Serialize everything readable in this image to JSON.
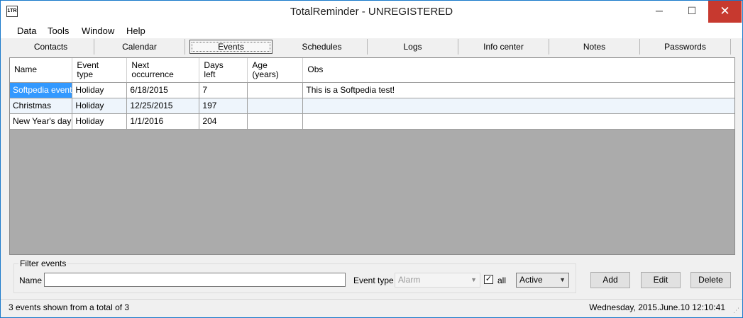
{
  "window": {
    "title": "TotalReminder - UNREGISTERED",
    "icon_text": "1TR",
    "minimize_glyph": "─",
    "maximize_glyph": "☐",
    "close_glyph": "✕"
  },
  "menu": [
    "Data",
    "Tools",
    "Window",
    "Help"
  ],
  "tabs": [
    "Contacts",
    "Calendar",
    "Events",
    "Schedules",
    "Logs",
    "Info center",
    "Notes",
    "Passwords"
  ],
  "active_tab": "Events",
  "table": {
    "columns": [
      {
        "line1": "Name",
        "line2": ""
      },
      {
        "line1": "Event",
        "line2": "type"
      },
      {
        "line1": "Next",
        "line2": "occurrence"
      },
      {
        "line1": "Days",
        "line2": "left"
      },
      {
        "line1": "Age",
        "line2": "(years)"
      },
      {
        "line1": "Obs",
        "line2": ""
      }
    ],
    "rows": [
      {
        "name": "Softpedia event",
        "type": "Holiday",
        "next": "6/18/2015",
        "days": "7",
        "age": "",
        "obs": "This is a Softpedia test!"
      },
      {
        "name": "Christmas",
        "type": "Holiday",
        "next": "12/25/2015",
        "days": "197",
        "age": "",
        "obs": ""
      },
      {
        "name": "New Year's day",
        "type": "Holiday",
        "next": "1/1/2016",
        "days": "204",
        "age": "",
        "obs": ""
      }
    ]
  },
  "filter": {
    "legend": "Filter events",
    "name_label": "Name",
    "name_value": "",
    "event_type_label": "Event type",
    "event_type_value": "Alarm",
    "all_label": "all",
    "all_checked": true,
    "status_value": "Active"
  },
  "buttons": {
    "add": "Add",
    "edit": "Edit",
    "delete": "Delete"
  },
  "status": {
    "summary": "3 events shown from a total of 3",
    "datetime": "Wednesday, 2015.June.10 12:10:41"
  }
}
